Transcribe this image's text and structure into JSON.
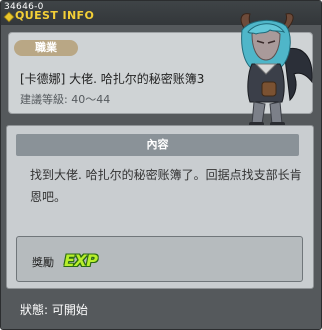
{
  "quest_id": "34646-0",
  "window_title": "QUEST INFO",
  "job_badge": "職業",
  "quest_name": "[卡德娜] 大佬. 哈扎尔的秘密账簿3",
  "recommended_level": "建議等級: 40～44",
  "content_header": "內容",
  "content_line1": "找到大佬. 哈扎尔的秘密账簿了。回据点找支部长肯",
  "content_line2": "恩吧。",
  "reward_label": "獎勵",
  "reward_icon_text": "EXP",
  "status_text": "狀態:  可開始",
  "colors": {
    "title_accent": "#f3cf37",
    "window_bg": "#55595c",
    "exp_green": "#b7ef2b"
  }
}
